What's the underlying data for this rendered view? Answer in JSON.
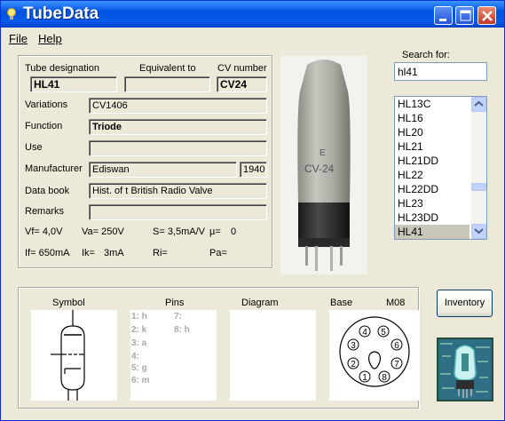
{
  "window": {
    "title": "TubeData"
  },
  "menu": {
    "file": "File",
    "help": "Help"
  },
  "labels": {
    "tube_designation": "Tube designation",
    "equivalent_to": "Equivalent to",
    "cv_number": "CV number",
    "variations": "Variations",
    "function": "Function",
    "use": "Use",
    "manufacturer": "Manufacturer",
    "data_book": "Data book",
    "remarks": "Remarks"
  },
  "values": {
    "tube_designation": "HL41",
    "equivalent_to": "",
    "cv_number": "CV24",
    "variations": "CV1406",
    "function": "Triode",
    "use": "",
    "manufacturer": "Ediswan",
    "year": "1940",
    "data_book": "Hist. of t British Radio Valve",
    "remarks": ""
  },
  "params": {
    "vf": "Vf= 4,0V",
    "va": "Va= 250V",
    "s": "S= 3,5mA/V",
    "mu": "µ=",
    "mu_value": "0",
    "if": "If= 650mA",
    "ik": "Ik=",
    "ik_value": "3mA",
    "ri": "Ri=",
    "pa": "Pa="
  },
  "photo": {
    "marking_line1": "E",
    "marking_line2": "CV-24"
  },
  "search": {
    "label": "Search for:",
    "value": "hl41"
  },
  "tube_list": {
    "items": [
      "HL13C",
      "HL16",
      "HL20",
      "HL21",
      "HL21DD",
      "HL22",
      "HL22DD",
      "HL23",
      "HL23DD",
      "HL41"
    ],
    "selected": "HL41"
  },
  "bottom": {
    "symbol": "Symbol",
    "pins": "Pins",
    "diagram": "Diagram",
    "base": "Base",
    "base_type": "M08",
    "pins_col1": [
      "1: h",
      "2: k",
      "3: a",
      "4:",
      "5: g",
      "6: m"
    ],
    "pins_col2": [
      "7:",
      "8: h"
    ],
    "base_pins": [
      "1",
      "2",
      "3",
      "4",
      "5",
      "6",
      "7",
      "8"
    ]
  },
  "buttons": {
    "inventory": "Inventory"
  },
  "icons": {
    "app": "lightbulb-icon",
    "minimize": "minimize-icon",
    "maximize": "maximize-icon",
    "close": "close-icon",
    "scroll_up": "chevron-up-icon",
    "scroll_down": "chevron-down-icon",
    "logo": "tube-logo-icon"
  },
  "colors": {
    "titlebar": "#0054e3",
    "window_bg": "#ece9d8",
    "list_selection": "#c9c7ba",
    "close_button": "#c2352b"
  }
}
